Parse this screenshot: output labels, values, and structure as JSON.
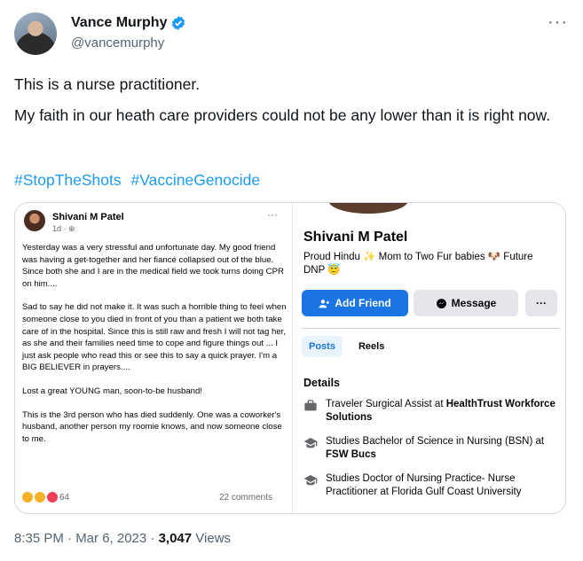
{
  "author": {
    "display_name": "Vance Murphy",
    "handle": "@vancemurphy",
    "verified_color": "#1d9bf0"
  },
  "more_glyph": "···",
  "tweet": {
    "paragraphs": [
      "This is a nurse practitioner.",
      "My faith in our heath care providers could not be any lower than it is right now."
    ],
    "hashtags": [
      "#StopTheShots",
      "#VaccineGenocide"
    ]
  },
  "fb_post": {
    "name": "Shivani M Patel",
    "time": "1d · ⊕",
    "more": "···",
    "paragraphs": [
      "Yesterday was a very stressful and unfortunate day. My good friend was having a get-together and her fiancé collapsed out of the blue. Since both she and I are in the medical field we took turns doing CPR on him....",
      "Sad to say he did not make it. It was such a horrible thing to feel when someone close to you died in front of you than a patient we both take care of in the hospital.  Since this is still raw and fresh I will not tag her, as she and their families need time to cope and figure things out ... I just ask people who read this or see this to say a quick prayer. I'm a BIG BELIEVER in prayers....",
      "Lost a great YOUNG man, soon-to-be husband!",
      "This is the 3rd person who has died suddenly. One was a coworker's husband, another person my roomie knows, and now someone close to me."
    ],
    "reaction_count": "64",
    "comments": "22 comments"
  },
  "fb_profile": {
    "name": "Shivani M Patel",
    "bio": "Proud Hindu ✨ Mom to Two Fur babies 🐶 Future DNP 😇",
    "add_friend": "Add Friend",
    "message": "Message",
    "more": "···",
    "tabs": [
      "Posts",
      "Reels"
    ],
    "details_heading": "Details",
    "details": [
      {
        "prefix": "Traveler Surgical Assist at ",
        "bold": "HealthTrust Workforce Solutions",
        "icon": "briefcase-icon"
      },
      {
        "prefix": "Studies Bachelor of Science in Nursing (BSN) at ",
        "bold": "FSW Bucs",
        "icon": "graduation-cap-icon"
      },
      {
        "prefix": "Studies Doctor of Nursing Practice- Nurse Practitioner at Florida Gulf Coast University",
        "bold": "",
        "icon": "graduation-cap-icon"
      }
    ]
  },
  "footer": {
    "time": "8:35 PM · Mar 6, 2023 · ",
    "views_count": "3,047",
    "views_label": " Views"
  }
}
